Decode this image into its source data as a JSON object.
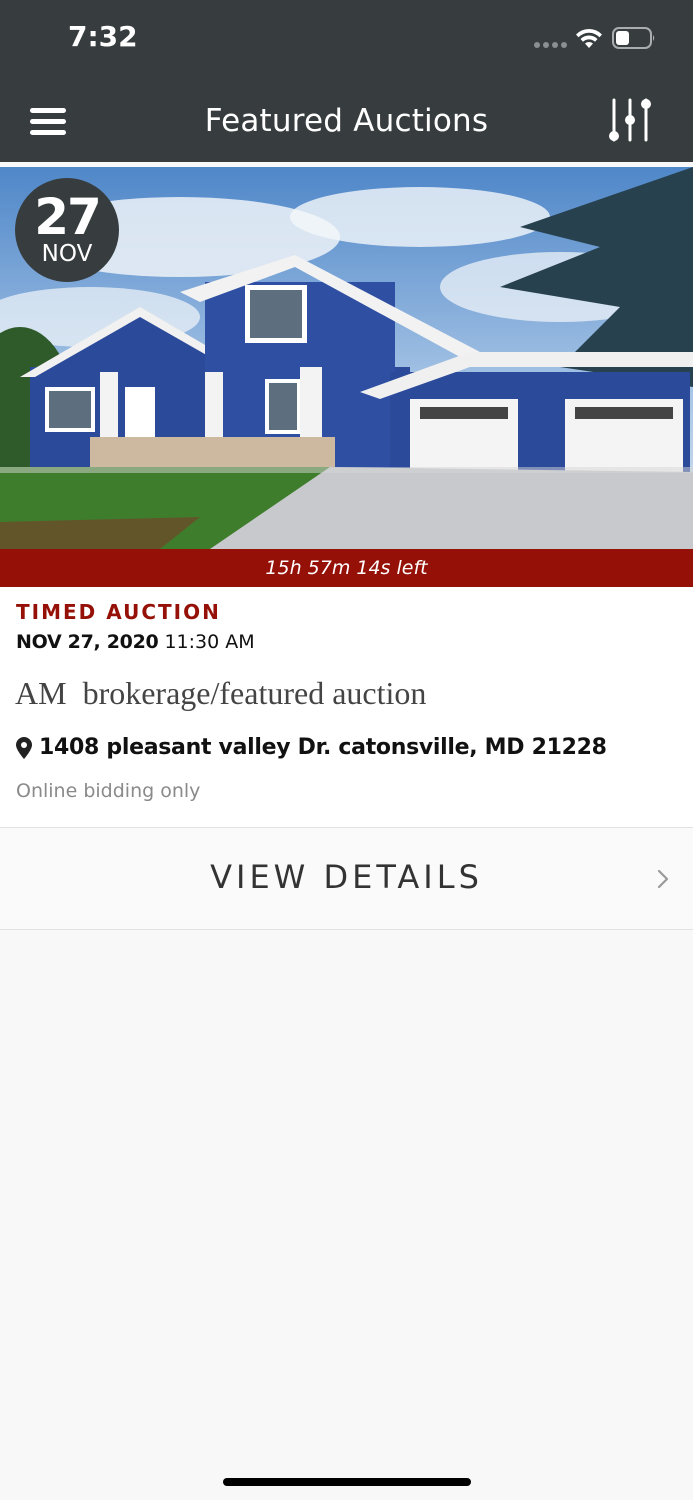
{
  "status_bar": {
    "time": "7:32"
  },
  "nav": {
    "title": "Featured Auctions",
    "menu_icon": "hamburger-menu-icon",
    "filter_icon": "sliders-filter-icon"
  },
  "listing": {
    "date_badge": {
      "day": "27",
      "month": "NOV"
    },
    "countdown": "15h 57m 14s left",
    "auction_type": "TIMED AUCTION",
    "date_bold": "NOV 27, 2020",
    "time": " 11:30 AM",
    "title": "AM  brokerage/featured auction",
    "address": "1408 pleasant valley Dr. catonsville, MD 21228",
    "bidding_note": "Online bidding only",
    "view_details_label": "VIEW DETAILS"
  },
  "colors": {
    "header_bg": "#373d3f",
    "accent_red": "#951108",
    "background": "#f8f8f8"
  }
}
